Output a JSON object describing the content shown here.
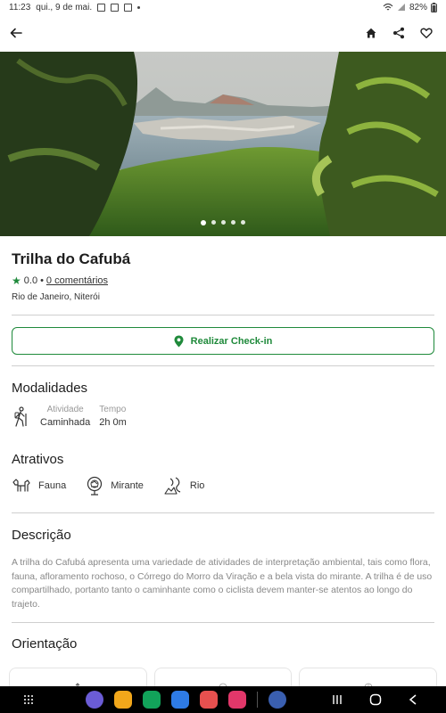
{
  "status_bar": {
    "time": "11:23",
    "date": "qui., 9 de mai.",
    "battery": "82%"
  },
  "app_bar": {
    "back_icon": "arrow-left-icon",
    "home_icon": "home-icon",
    "share_icon": "share-icon",
    "favorite_icon": "heart-outline-icon"
  },
  "gallery": {
    "page_count": 5,
    "active_index": 0
  },
  "trail": {
    "title": "Trilha do Cafubá",
    "rating": "0.0",
    "comments": "0 comentários",
    "location": "Rio de Janeiro, Niterói"
  },
  "checkin": {
    "label": "Realizar Check-in",
    "icon": "map-pin-icon"
  },
  "modalidades": {
    "title": "Modalidades",
    "activity_label": "Atividade",
    "activity_value": "Caminhada",
    "time_label": "Tempo",
    "time_value": "2h 0m",
    "icon": "hiker-icon"
  },
  "atrativos": {
    "title": "Atrativos",
    "items": [
      {
        "label": "Fauna",
        "icon": "fauna-icon"
      },
      {
        "label": "Mirante",
        "icon": "viewpoint-icon"
      },
      {
        "label": "Rio",
        "icon": "river-icon"
      }
    ]
  },
  "descricao": {
    "title": "Descrição",
    "text": "A trilha do Cafubá apresenta uma variedade de atividades  de interpretação ambiental, tais como flora, fauna, afloramento rochoso, o Córrego do Morro da Viração e a bela vista do mirante. A trilha é de uso compartilhado, portanto tanto o caminhante como o ciclista devem manter-se atentos ao longo do trajeto."
  },
  "orientacao": {
    "title": "Orientação"
  },
  "colors": {
    "accent": "#1f8a3b"
  }
}
